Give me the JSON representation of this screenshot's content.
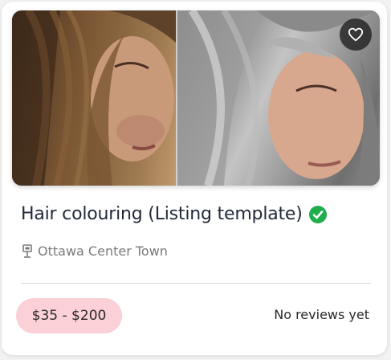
{
  "listing": {
    "title": "Hair colouring (Listing template)",
    "verified": true,
    "location": "Ottawa Center Town",
    "price_range": "$35 - $200",
    "reviews_text": "No reviews yet"
  },
  "icons": {
    "favorite": "heart-outline-icon",
    "verified": "check-circle-icon",
    "location": "map-pin-icon"
  },
  "colors": {
    "verified_green": "#1fae4b",
    "price_badge_bg": "#fbd0d6",
    "title_text": "#222a3a",
    "muted_text": "#7a7a7a"
  }
}
